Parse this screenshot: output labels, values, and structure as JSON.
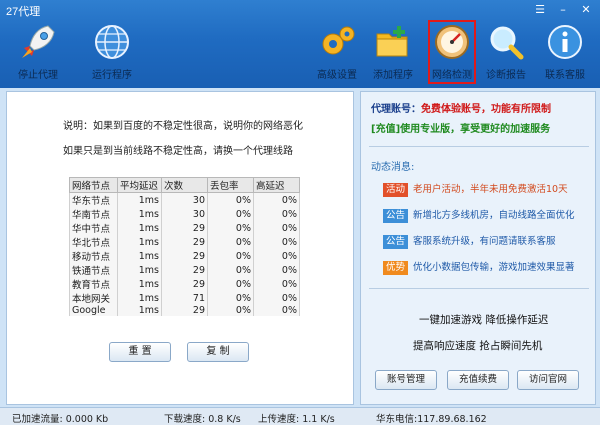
{
  "window": {
    "title": "27代理",
    "menu_icon": "menu-icon",
    "minimize_icon": "minimize-icon",
    "close_icon": "close-icon"
  },
  "toolbar": {
    "stop": {
      "label": "停止代理",
      "icon": "rocket-icon"
    },
    "run": {
      "label": "运行程序",
      "icon": "globe-icon"
    },
    "advanced": {
      "label": "高级设置",
      "icon": "gear-icon"
    },
    "add_program": {
      "label": "添加程序",
      "icon": "folder-plus-icon"
    },
    "net_check": {
      "label": "网络检测",
      "icon": "gauge-icon"
    },
    "diagnose": {
      "label": "诊断报告",
      "icon": "magnifier-icon"
    },
    "contact": {
      "label": "联系客服",
      "icon": "info-icon"
    }
  },
  "left": {
    "desc1": "说明：如果到百度的不稳定性很高，说明你的网络恶化",
    "desc2": "如果只是到当前线路不稳定性高，请换一个代理线路",
    "table": {
      "headers": [
        "网络节点",
        "平均延迟",
        "次数",
        "丢包率",
        "高延迟"
      ],
      "rows": [
        [
          "华东节点",
          "1ms",
          "30",
          "0%",
          "0%"
        ],
        [
          "华南节点",
          "1ms",
          "30",
          "0%",
          "0%"
        ],
        [
          "华中节点",
          "1ms",
          "29",
          "0%",
          "0%"
        ],
        [
          "华北节点",
          "1ms",
          "29",
          "0%",
          "0%"
        ],
        [
          "移动节点",
          "1ms",
          "29",
          "0%",
          "0%"
        ],
        [
          "铁通节点",
          "1ms",
          "29",
          "0%",
          "0%"
        ],
        [
          "教育节点",
          "1ms",
          "29",
          "0%",
          "0%"
        ],
        [
          "本地网关",
          "1ms",
          "71",
          "0%",
          "0%"
        ],
        [
          "Google",
          "1ms",
          "29",
          "0%",
          "0%"
        ]
      ]
    },
    "reset_label": "重 置",
    "copy_label": "复 制"
  },
  "right": {
    "account_key": "代理账号：",
    "account_value": "免费体验账号，功能有所限制",
    "upgrade_key": "[充值]",
    "upgrade_value": "使用专业版，享受更好的加速服务",
    "news_head": "动态消息:",
    "news": [
      {
        "tag": "活动",
        "text": "老用户活动，半年未用免费激活10天"
      },
      {
        "tag": "公告",
        "text": "新增北方多线机房，自动线路全面优化"
      },
      {
        "tag": "公告",
        "text": "客服系统升级，有问题请联系客服"
      },
      {
        "tag": "优势",
        "text": "优化小数据包传输，游戏加速效果显著"
      }
    ],
    "promo1": "一键加速游戏  降低操作延迟",
    "promo2": "提高响应速度  抢占瞬间先机",
    "btn_account": "账号管理",
    "btn_recharge": "充值续费",
    "btn_site": "访问官网"
  },
  "status": {
    "traffic": "已加速流量: 0.000 Kb",
    "down": "下载速度: 0.8 K/s",
    "up": "上传速度: 1.1 K/s",
    "server": "华东电信:117.89.68.162"
  }
}
